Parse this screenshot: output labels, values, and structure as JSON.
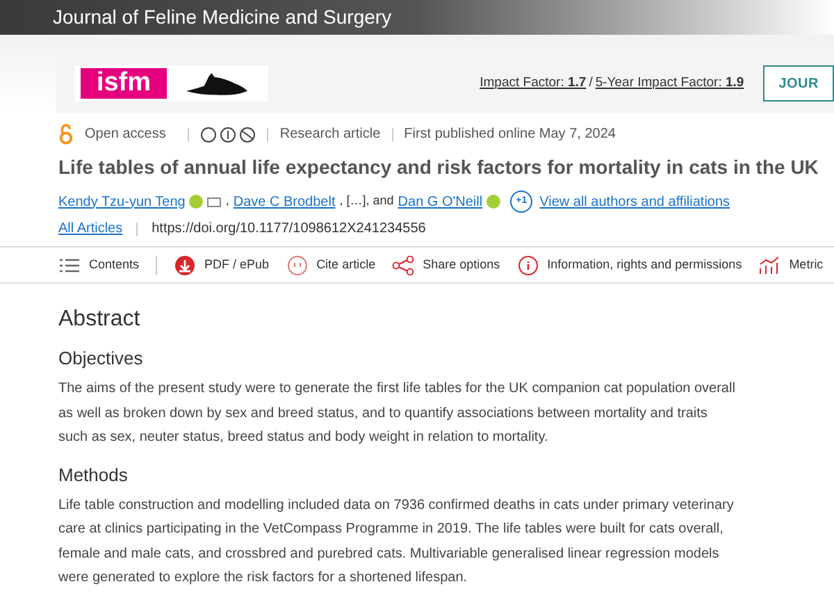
{
  "journal_title": "Journal of Feline Medicine and Surgery",
  "banner": {
    "logo_text": "isfm",
    "impact": [
      {
        "label": "Impact Factor:",
        "value": "1.7"
      },
      {
        "label": "5-Year Impact Factor:",
        "value": "1.9"
      }
    ],
    "separator": "/",
    "button": "JOUR"
  },
  "meta": {
    "access": "Open access",
    "type": "Research article",
    "published": "First published online May 7, 2024"
  },
  "title": "Life tables of annual life expectancy and risk factors for mortality in cats in the UK",
  "authors": [
    {
      "name": "Kendy Tzu-yun Teng",
      "orcid": true,
      "email": true,
      "after": ","
    },
    {
      "name": "Dave C Brodbelt",
      "orcid": false,
      "email": false,
      "after": ", […], and"
    },
    {
      "name": "Dan G O'Neill",
      "orcid": true,
      "email": false
    }
  ],
  "more_authors": "+1",
  "all_authors_link": "View all authors and affiliations",
  "all_articles": "All Articles",
  "doi": "https://doi.org/10.1177/1098612X241234556",
  "toolbar": [
    {
      "kind": "contents",
      "label": "Contents"
    },
    {
      "kind": "pdf",
      "label": "PDF / ePub"
    },
    {
      "kind": "cite",
      "label": "Cite article"
    },
    {
      "kind": "share",
      "label": "Share options"
    },
    {
      "kind": "info",
      "label": "Information, rights and permissions"
    },
    {
      "kind": "metrics",
      "label": "Metric"
    }
  ],
  "abstract": {
    "heading": "Abstract",
    "sections": [
      {
        "heading": "Objectives",
        "text": "The aims of the present study were to generate the first life tables for the UK companion cat population overall as well as broken down by sex and breed status, and to quantify associations between mortality and traits such as sex, neuter status, breed status and body weight in relation to mortality."
      },
      {
        "heading": "Methods",
        "text": "Life table construction and modelling included data on 7936 confirmed deaths in cats under primary veterinary care at clinics participating in the VetCompass Programme in 2019. The life tables were built for cats overall, female and male cats, and crossbred and purebred cats. Multivariable generalised linear regression models were generated to explore the risk factors for a shortened lifespan."
      }
    ]
  }
}
